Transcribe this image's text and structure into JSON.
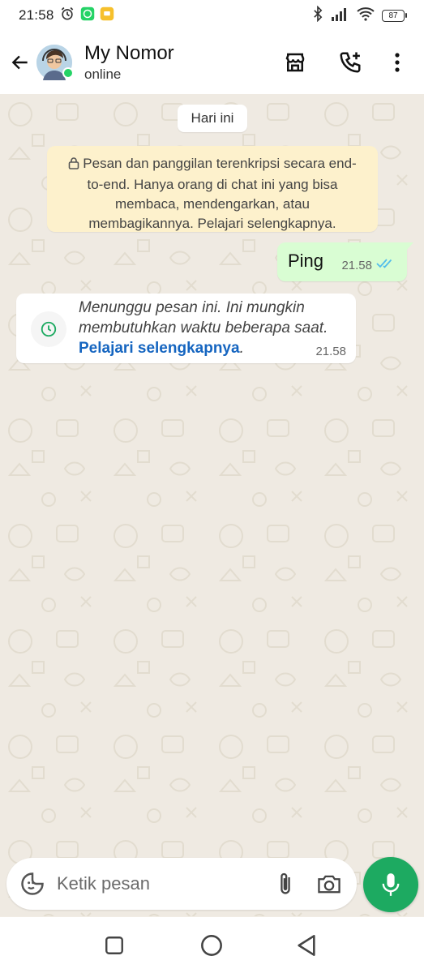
{
  "status_bar": {
    "time": "21:58",
    "battery": "87",
    "icons": [
      "alarm-icon",
      "whatsapp-notification-icon",
      "message-notification-icon",
      "bluetooth-icon",
      "signal-icon",
      "wifi-icon",
      "battery-icon"
    ]
  },
  "app_bar": {
    "contact_name": "My Nomor",
    "contact_status": "online",
    "icons": [
      "back-arrow-icon",
      "store-icon",
      "add-call-icon",
      "more-vert-icon"
    ]
  },
  "chat": {
    "date_chip": "Hari ini",
    "encryption_notice": "Pesan dan panggilan terenkripsi secara end-to-end. Hanya orang di chat ini yang bisa membaca, mendengarkan, atau membagikannya. Pelajari selengkapnya.",
    "outgoing": {
      "text": "Ping",
      "time": "21.58",
      "status": "double-check-icon"
    },
    "incoming": {
      "text": "Menunggu pesan ini. Ini mungkin membutuhkan waktu beberapa saat.",
      "link": "Pelajari selengkapnya",
      "link_suffix": ".",
      "time": "21.58"
    }
  },
  "composer": {
    "placeholder": "Ketik pesan"
  },
  "colors": {
    "accent": "#1daa61",
    "outgoing_bubble": "#d9fdd3",
    "notice_bubble": "#fdf1cc",
    "tick_blue": "#53bdeb",
    "link": "#1565c0"
  }
}
